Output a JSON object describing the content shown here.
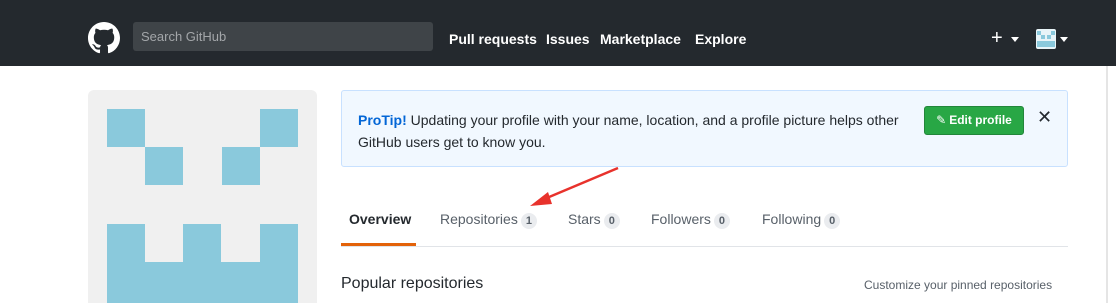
{
  "header": {
    "search_placeholder": "Search GitHub",
    "nav": [
      "Pull requests",
      "Issues",
      "Marketplace",
      "Explore"
    ],
    "plus_label": "+"
  },
  "tip": {
    "lead": "ProTip!",
    "text": "Updating your profile with your name, location, and a profile picture helps other GitHub users get to know you.",
    "edit_label": "Edit profile",
    "close_label": "✕"
  },
  "tabs": [
    {
      "label": "Overview",
      "count": null
    },
    {
      "label": "Repositories",
      "count": "1"
    },
    {
      "label": "Stars",
      "count": "0"
    },
    {
      "label": "Followers",
      "count": "0"
    },
    {
      "label": "Following",
      "count": "0"
    }
  ],
  "popular": {
    "title": "Popular repositories",
    "customize": "Customize your pinned repositories"
  },
  "colors": {
    "header_bg": "#24292e",
    "identicon": "#8ac9dc",
    "accent_tab": "#e36209",
    "edit_btn": "#28a745",
    "arrow": "#e8322c"
  }
}
